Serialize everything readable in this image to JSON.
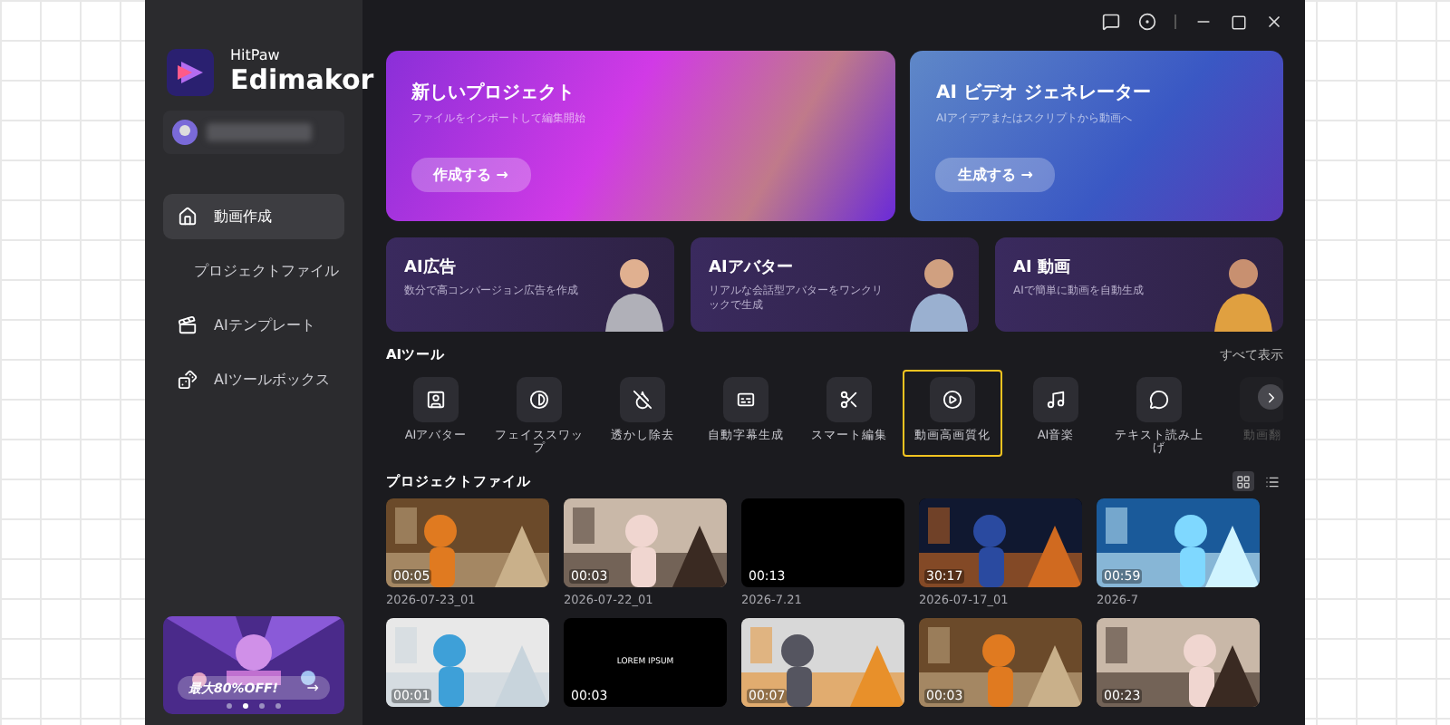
{
  "brand": {
    "top": "HitPaw",
    "name": "Edimakor"
  },
  "sidebar": {
    "items": [
      {
        "label": "動画作成",
        "selected": true
      },
      {
        "label": "プロジェクトファイル",
        "selected": false
      },
      {
        "label": "AIテンプレート",
        "selected": false
      },
      {
        "label": "AIツールボックス",
        "selected": false
      }
    ]
  },
  "promo": {
    "text": "最大80%OFF!",
    "arrow": "→",
    "dots": [
      {
        "selected": false
      },
      {
        "selected": true
      },
      {
        "selected": false
      },
      {
        "selected": false
      }
    ]
  },
  "hero": [
    {
      "kind": "pink",
      "title": "新しいプロジェクト",
      "subtitle": "ファイルをインポートして編集開始",
      "button": "作成する →"
    },
    {
      "kind": "blue",
      "title": "AI ビデオ ジェネレーター",
      "subtitle": "AIアイデアまたはスクリプトから動画へ",
      "button": "生成する →"
    }
  ],
  "features": [
    {
      "title": "AI広告",
      "subtitle": "数分で高コンバージョン広告を作成"
    },
    {
      "title": "AIアバター",
      "subtitle": "リアルな会話型アバターをワンクリックで生成"
    },
    {
      "title": "AI 動画",
      "subtitle": "AIで簡単に動画を自動生成"
    }
  ],
  "tools": {
    "title": "AIツール",
    "view_all": "すべて表示",
    "items": [
      {
        "label": "AIアバター",
        "selected": false
      },
      {
        "label": "フェイススワップ",
        "selected": false
      },
      {
        "label": "透かし除去",
        "selected": false
      },
      {
        "label": "自動字幕生成",
        "selected": false
      },
      {
        "label": "スマート編集",
        "selected": false
      },
      {
        "label": "動画高画質化",
        "selected": true
      },
      {
        "label": "AI音楽",
        "selected": false
      },
      {
        "label": "テキスト読み上げ",
        "selected": false
      },
      {
        "label": "動画翻",
        "selected": false
      }
    ]
  },
  "projects": {
    "title": "プロジェクトファイル",
    "views": [
      {
        "kind": "grid",
        "selected": true
      },
      {
        "kind": "list",
        "selected": false
      }
    ],
    "items": [
      {
        "kind": "picture",
        "duration": "00:05",
        "name": "2026-07-23_01"
      },
      {
        "kind": "picture",
        "duration": "00:03",
        "name": "2026-07-22_01"
      },
      {
        "kind": "blank",
        "duration": "00:13",
        "name": "2026-7.21"
      },
      {
        "kind": "picture",
        "duration": "30:17",
        "name": "2026-07-17_01"
      },
      {
        "kind": "picture",
        "duration": "00:59",
        "name": "2026-7"
      },
      {
        "kind": "picture",
        "duration": "00:01"
      },
      {
        "kind": "blank",
        "duration": "00:03",
        "caption": "LOREM IPSUM"
      },
      {
        "kind": "picture",
        "duration": "00:07"
      },
      {
        "kind": "picture",
        "duration": "00:03"
      },
      {
        "kind": "picture",
        "duration": "00:23"
      }
    ]
  }
}
